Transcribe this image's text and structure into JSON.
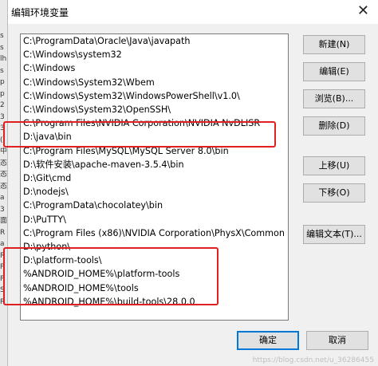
{
  "window": {
    "title": "编辑环境变量",
    "close_glyph": "✕"
  },
  "path_list": [
    "C:\\ProgramData\\Oracle\\Java\\javapath",
    "C:\\Windows\\system32",
    "C:\\Windows",
    "C:\\Windows\\System32\\Wbem",
    "C:\\Windows\\System32\\WindowsPowerShell\\v1.0\\",
    "C:\\Windows\\System32\\OpenSSH\\",
    "C:\\Program Files\\NVIDIA Corporation\\NVIDIA NvDLISR",
    "D:\\java\\bin",
    "C:\\Program Files\\MySQL\\MySQL Server 8.0\\bin",
    "D:\\软件安装\\apache-maven-3.5.4\\bin",
    "D:\\Git\\cmd",
    "D:\\nodejs\\",
    "C:\\ProgramData\\chocolatey\\bin",
    "D:\\PuTTY\\",
    "C:\\Program Files (x86)\\NVIDIA Corporation\\PhysX\\Common",
    "D:\\python\\",
    "D:\\platform-tools\\",
    "%ANDROID_HOME%\\platform-tools",
    "%ANDROID_HOME%\\tools",
    "%ANDROID_HOME%\\build-tools\\28.0.0"
  ],
  "buttons": {
    "new": "新建(N)",
    "edit": "编辑(E)",
    "browse": "浏览(B)...",
    "delete": "删除(D)",
    "move_up": "上移(U)",
    "move_down": "下移(O)",
    "edit_text": "编辑文本(T)...",
    "ok": "确定",
    "cancel": "取消"
  },
  "left_strip_chars": [
    "s",
    "s",
    "lh",
    "s",
    "p",
    "p",
    "2",
    "3",
    "3",
    "(",
    "中",
    "态",
    "态",
    "态",
    "a",
    "3",
    "面",
    "R",
    "a",
    "R",
    "P",
    "P",
    "S",
    "R"
  ],
  "watermark": "https://blog.csdn.net/u_36286455",
  "colors": {
    "highlight_box": "#e02020",
    "default_button_border": "#0078d7"
  }
}
